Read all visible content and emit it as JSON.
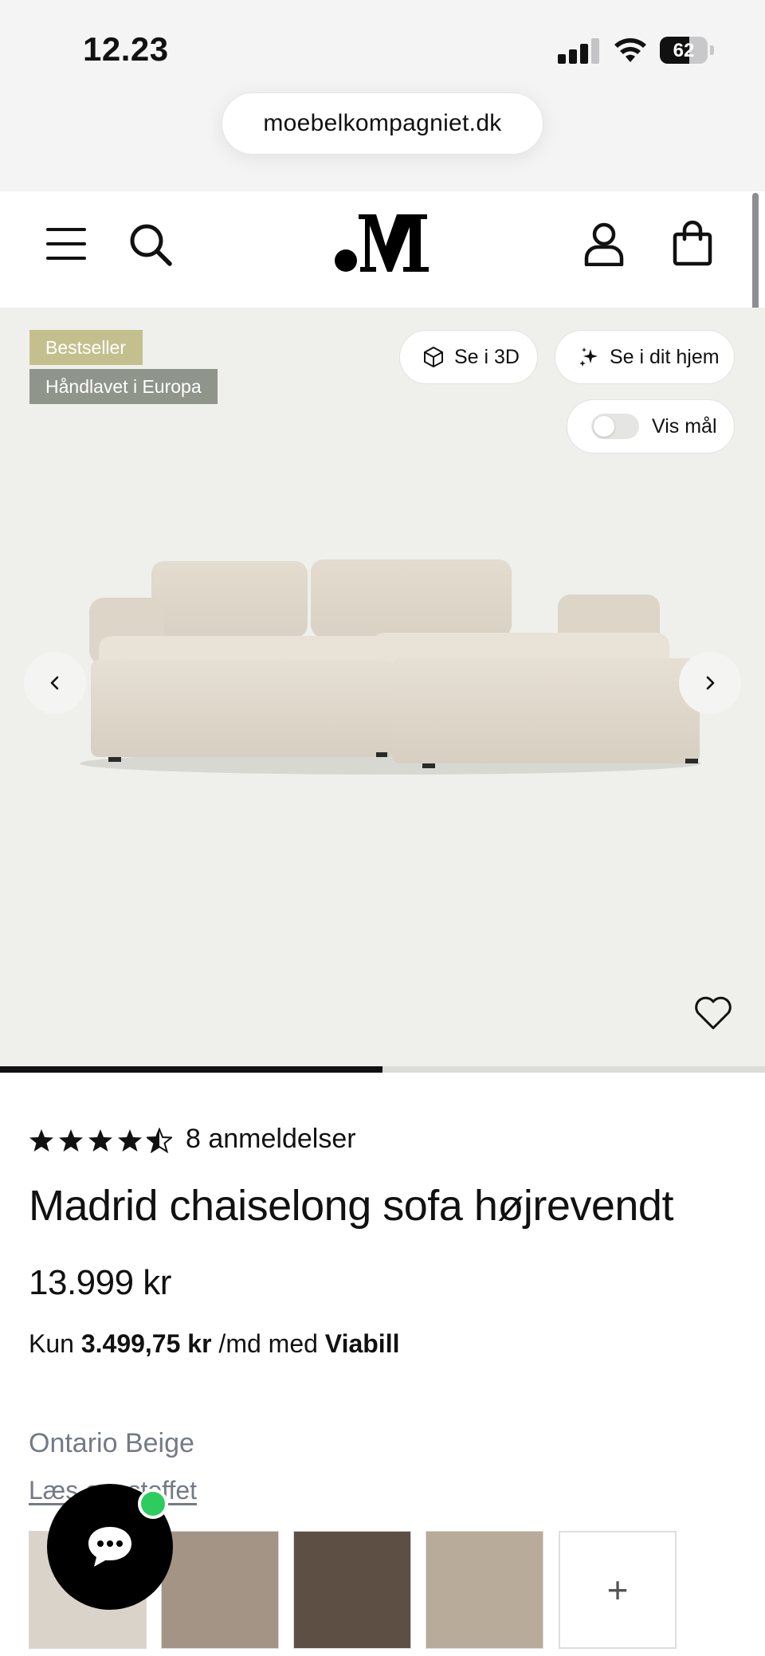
{
  "status_bar": {
    "time": "12.23",
    "battery": "62"
  },
  "browser": {
    "url": "moebelkompagniet.dk"
  },
  "header": {
    "logo_text": ".M",
    "icons": [
      "menu-icon",
      "search-icon",
      "account-icon",
      "cart-icon"
    ]
  },
  "gallery": {
    "badges": [
      "Bestseller",
      "Håndlavet i Europa"
    ],
    "view_3d_label": "Se i 3D",
    "view_home_label": "Se i dit hjem",
    "show_dimensions_label": "Vis mål",
    "image_progress": 0.5
  },
  "product": {
    "rating": 4.5,
    "reviews_label": "8 anmeldelser",
    "title": "Madrid chaiselong sofa højrevendt",
    "price": "13.999 kr",
    "financing": {
      "prefix": "Kun",
      "amount": "3.499,75 kr",
      "middle": "/md med",
      "provider": "Viabill"
    },
    "color_name": "Ontario Beige",
    "fabric_link": "Læs om stoffet",
    "swatches": [
      {
        "color": "#d9d3c9"
      },
      {
        "color": "#a39486"
      },
      {
        "color": "#5d4f43"
      },
      {
        "color": "#b9ab99"
      }
    ],
    "more_swatches_label": "+"
  },
  "colors": {
    "badge_bestseller": "#c4c08e",
    "badge_handmade": "#8f958b",
    "chat_online": "#2ecc5f",
    "muted_text": "#747a85"
  }
}
